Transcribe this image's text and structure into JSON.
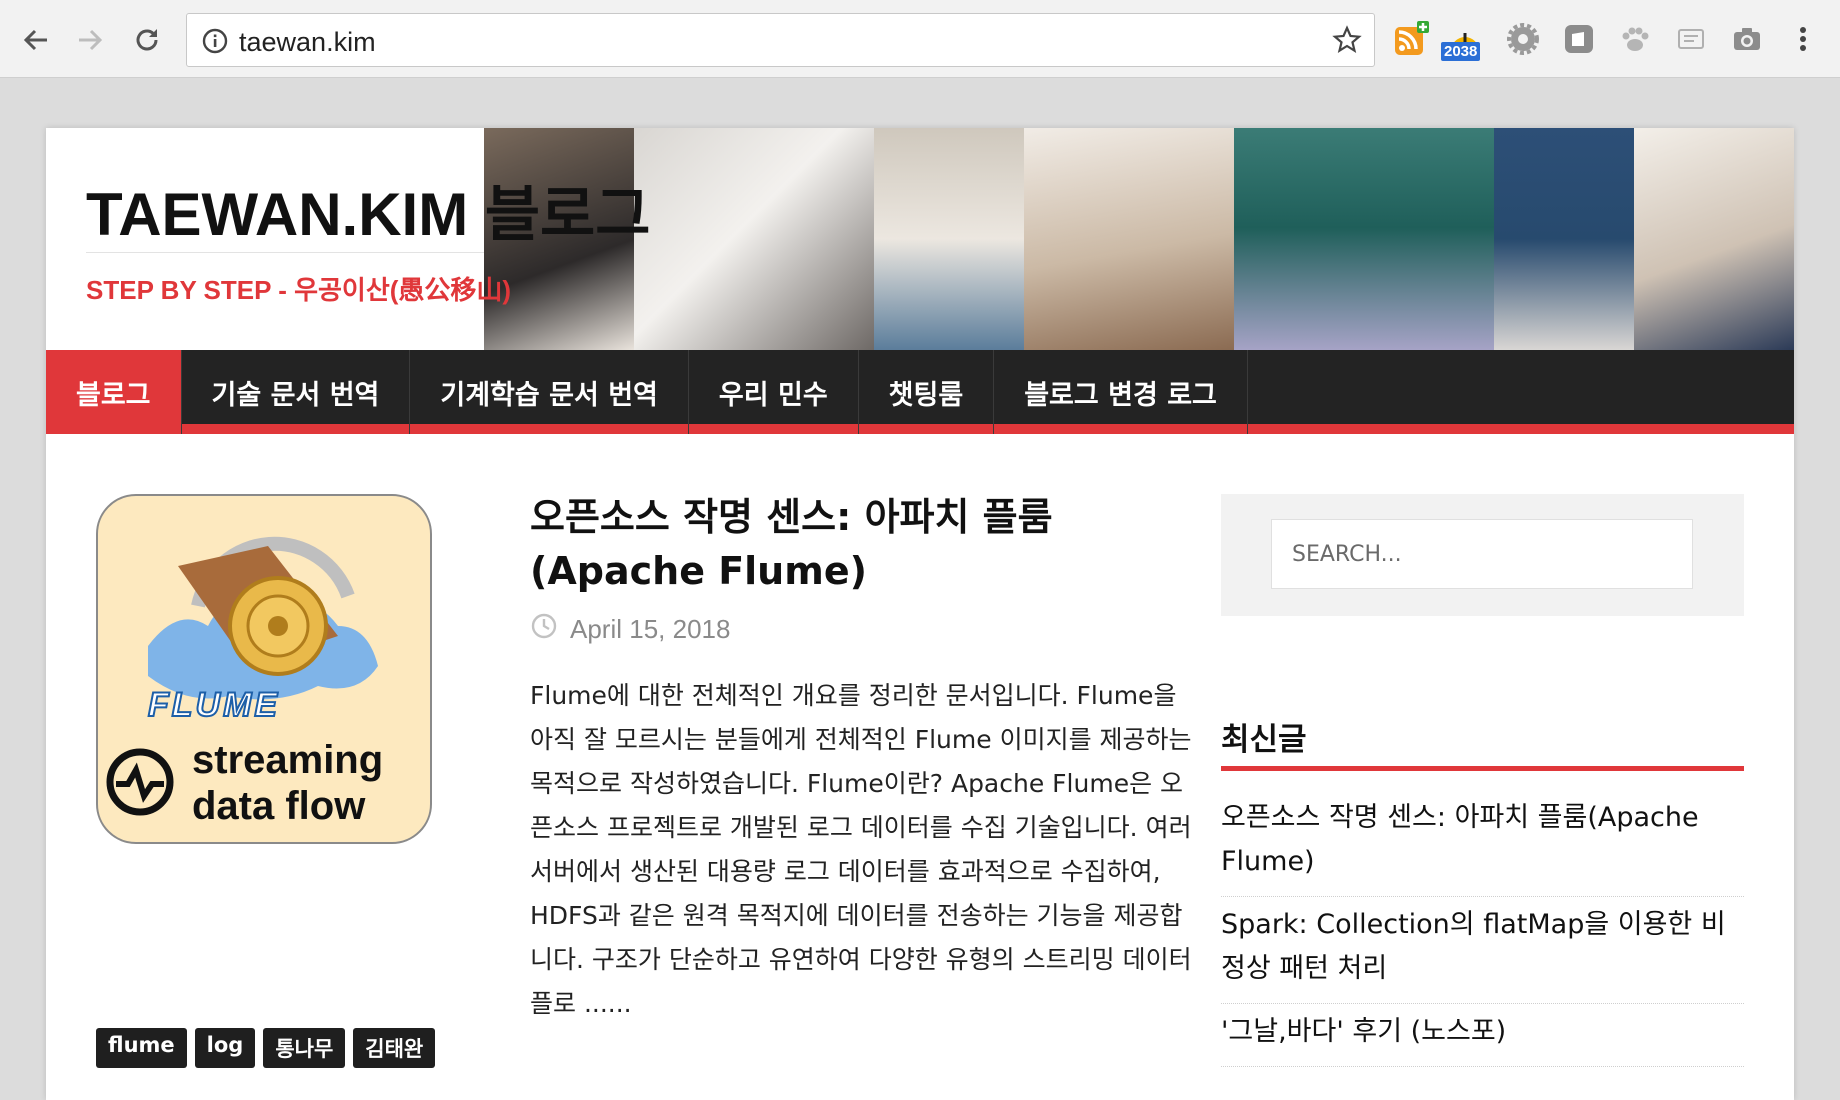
{
  "browser": {
    "url": "taewan.kim",
    "extension_badge": "2038",
    "icons": [
      "back-arrow-icon",
      "forward-arrow-icon",
      "reload-icon",
      "info-icon",
      "star-icon",
      "rss-add-icon",
      "notification-icon",
      "settings-gear-icon",
      "square-extension-icon",
      "paw-icon",
      "reader-icon",
      "camera-icon",
      "kebab-menu-icon"
    ]
  },
  "site": {
    "title": "TAEWAN.KIM 블로그",
    "tagline": "STEP BY STEP - 우공이산(愚公移山)"
  },
  "menu": {
    "items": [
      "블로그",
      "기술 문서 번역",
      "기계학습 문서 번역",
      "우리 민수",
      "챗팅룸",
      "블로그 변경 로그"
    ],
    "active": "블로그"
  },
  "post": {
    "title": "오픈소스 작명 센스: 아파치 플룸(Apache Flume)",
    "date": "April 15, 2018",
    "excerpt": "Flume에 대한 전체적인 개요를 정리한 문서입니다. Flume을 아직 잘 모르시는 분들에게 전체적인 Flume 이미지를 제공하는 목적으로 작성하였습니다. Flume이란? Apache Flume은 오픈소스 프로젝트로 개발된 로그 데이터를 수집 기술입니다. 여러 서버에서 생산된 대용량 로그 데이터를 효과적으로 수집하여, HDFS과 같은 원격 목적지에 데이터를 전송하는 기능을 제공합니다. 구조가 단순하고 유연하여 다양한 유형의 스트리밍 데이터 플로 ......",
    "thumbnail": {
      "logo_word": "FLUME",
      "line1": "streaming",
      "line2": "data flow"
    },
    "tags": [
      "flume",
      "log",
      "통나무",
      "김태완"
    ]
  },
  "sidebar": {
    "search_placeholder": "SEARCH...",
    "recent_title": "최신글",
    "recent_posts": [
      "오픈소스 작명 센스: 아파치 플룸(Apache Flume)",
      "Spark: Collection의 flatMap을 이용한 비정상 패턴 처리",
      "'그날,바다' 후기 (노스포)"
    ]
  },
  "colors": {
    "accent": "#e0373a",
    "menu_bg": "#232323",
    "thumb_bg": "#fde9bf"
  }
}
